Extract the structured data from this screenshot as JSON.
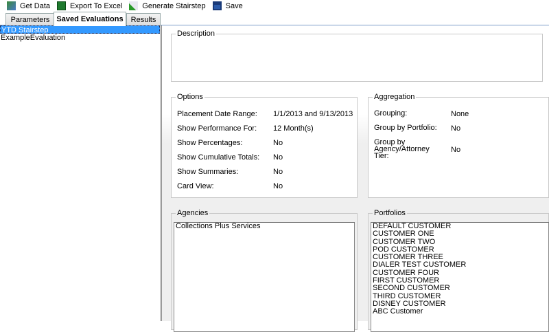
{
  "toolbar": {
    "items": [
      {
        "label": "Get Data",
        "icon": "get-data-icon"
      },
      {
        "label": "Export To Excel",
        "icon": "excel-icon"
      },
      {
        "label": "Generate Stairstep",
        "icon": "chart-icon"
      },
      {
        "label": "Save",
        "icon": "save-icon"
      }
    ]
  },
  "tabs": [
    {
      "label": "Parameters"
    },
    {
      "label": "Saved Evaluations",
      "active": true
    },
    {
      "label": "Results"
    }
  ],
  "evaluations": [
    {
      "label": "YTD Stairstep",
      "selected": true
    },
    {
      "label": "ExampleEvaluation"
    }
  ],
  "description": {
    "title": "Description"
  },
  "options": {
    "title": "Options",
    "rows": [
      {
        "label": "Placement Date Range:",
        "value": "1/1/2013 and 9/13/2013"
      },
      {
        "label": "Show Performance For:",
        "value": "12 Month(s)"
      },
      {
        "label": "Show Percentages:",
        "value": "No"
      },
      {
        "label": "Show Cumulative Totals:",
        "value": "No"
      },
      {
        "label": "Show Summaries:",
        "value": "No"
      },
      {
        "label": "Card View:",
        "value": "No"
      }
    ]
  },
  "aggregation": {
    "title": "Aggregation",
    "rows": [
      {
        "label": "Grouping:",
        "value": "None"
      },
      {
        "label": "Group by Portfolio:",
        "value": "No"
      },
      {
        "label": "Group by Agency/Attorney Tier:",
        "value": "No"
      }
    ]
  },
  "agencies": {
    "title": "Agencies",
    "items": [
      "Collections Plus Services"
    ]
  },
  "portfolios": {
    "title": "Portfolios",
    "items": [
      "DEFAULT CUSTOMER",
      "CUSTOMER ONE",
      "CUSTOMER TWO",
      "POD CUSTOMER",
      "CUSTOMER THREE",
      "DIALER TEST CUSTOMER",
      "CUSTOMER FOUR",
      "FIRST CUSTOMER",
      "SECOND CUSTOMER",
      "THIRD CUSTOMER",
      "DISNEY CUSTOMER",
      "ABC Customer"
    ]
  }
}
